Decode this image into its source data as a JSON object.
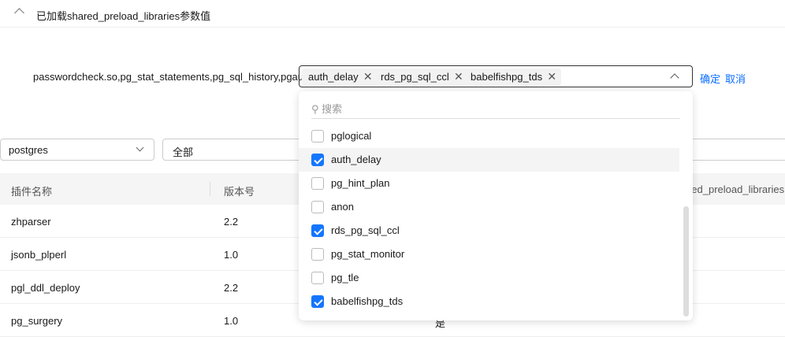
{
  "section": {
    "title": "已加载shared_preload_libraries参数值"
  },
  "current_value": "passwordcheck.so,pg_stat_statements,pg_sql_history,pgaudit",
  "select": {
    "tags": [
      "auth_delay",
      "rds_pg_sql_ccl",
      "babelfishpg_tds"
    ],
    "confirm": "确定",
    "cancel": "取消"
  },
  "dropdown": {
    "search_placeholder": "搜索",
    "items": [
      {
        "label": "pglogical",
        "checked": false
      },
      {
        "label": "auth_delay",
        "checked": true
      },
      {
        "label": "pg_hint_plan",
        "checked": false
      },
      {
        "label": "anon",
        "checked": false
      },
      {
        "label": "rds_pg_sql_ccl",
        "checked": true
      },
      {
        "label": "pg_stat_monitor",
        "checked": false
      },
      {
        "label": "pg_tle",
        "checked": false
      },
      {
        "label": "babelfishpg_tds",
        "checked": true
      }
    ]
  },
  "filters": {
    "database": "postgres",
    "status": "全部"
  },
  "table": {
    "headers": [
      "插件名称",
      "版本号",
      "shared_preload_libraries"
    ],
    "rows": [
      [
        "zhparser",
        "2.2"
      ],
      [
        "jsonb_plperl",
        "1.0"
      ],
      [
        "pgl_ddl_deploy",
        "2.2"
      ],
      [
        "pg_surgery",
        "1.0",
        "是"
      ]
    ]
  },
  "colors": {
    "accent": "#1476ff",
    "link": "#0a6cff"
  }
}
